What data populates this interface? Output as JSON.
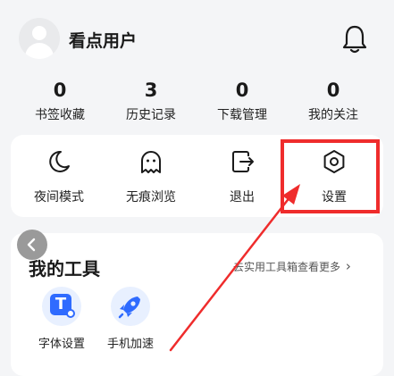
{
  "profile": {
    "username": "看点用户"
  },
  "stats": [
    {
      "value": "0",
      "label": "书签收藏"
    },
    {
      "value": "3",
      "label": "历史记录"
    },
    {
      "value": "0",
      "label": "下载管理"
    },
    {
      "value": "0",
      "label": "我的关注"
    }
  ],
  "features": [
    {
      "label": "夜间模式",
      "icon": "moon-icon"
    },
    {
      "label": "无痕浏览",
      "icon": "ghost-icon"
    },
    {
      "label": "退出",
      "icon": "exit-icon"
    },
    {
      "label": "设置",
      "icon": "gear-icon"
    }
  ],
  "tools": {
    "title": "我的工具",
    "link": "去实用工具箱查看更多",
    "link_chevron": "›",
    "items": [
      {
        "label": "字体设置",
        "icon": "font-settings-icon",
        "icon_letter": "T"
      },
      {
        "label": "手机加速",
        "icon": "rocket-icon"
      }
    ]
  },
  "colors": {
    "accent": "#2f6bff",
    "highlight": "#ef2c2c"
  }
}
